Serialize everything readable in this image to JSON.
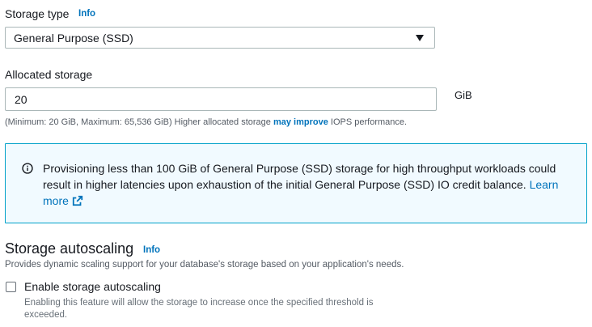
{
  "storage_type": {
    "label": "Storage type",
    "info": "Info",
    "selected": "General Purpose (SSD)"
  },
  "allocated_storage": {
    "label": "Allocated storage",
    "value": "20",
    "unit": "GiB",
    "hint_prefix": "(Minimum: 20 GiB, Maximum: 65,536 GiB) Higher allocated storage ",
    "hint_emphasis": "may improve",
    "hint_suffix": " IOPS performance."
  },
  "alert": {
    "text": "Provisioning less than 100 GiB of General Purpose (SSD) storage for high throughput workloads could result in higher latencies upon exhaustion of the initial General Purpose (SSD) IO credit balance. ",
    "link": "Learn more",
    "icon": "info-circle-icon",
    "border_color": "#00a1c9",
    "background": "#f1faff"
  },
  "autoscaling": {
    "title": "Storage autoscaling",
    "info": "Info",
    "description": "Provides dynamic scaling support for your database's storage based on your application's needs.",
    "checkbox_label": "Enable storage autoscaling",
    "checkbox_checked": false,
    "checkbox_description": "Enabling this feature will allow the storage to increase once the specified threshold is exceeded."
  },
  "colors": {
    "link": "#0073bb",
    "text": "#16191f",
    "muted": "#545b64"
  }
}
